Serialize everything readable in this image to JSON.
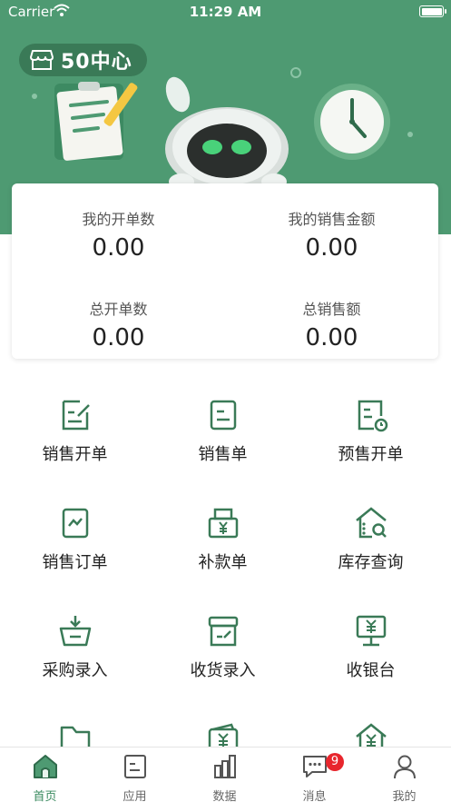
{
  "status_bar": {
    "carrier": "Carrier",
    "time": "11:29 AM"
  },
  "header": {
    "store_name": "50中心"
  },
  "stats": [
    {
      "label": "我的开单数",
      "value": "0.00"
    },
    {
      "label": "我的销售金额",
      "value": "0.00"
    },
    {
      "label": "总开单数",
      "value": "0.00"
    },
    {
      "label": "总销售额",
      "value": "0.00"
    }
  ],
  "features": [
    {
      "label": "销售开单",
      "icon": "edit-document-icon"
    },
    {
      "label": "销售单",
      "icon": "document-icon"
    },
    {
      "label": "预售开单",
      "icon": "document-clock-icon"
    },
    {
      "label": "销售订单",
      "icon": "chart-document-icon"
    },
    {
      "label": "补款单",
      "icon": "yuan-printer-icon"
    },
    {
      "label": "库存查询",
      "icon": "warehouse-search-icon"
    },
    {
      "label": "采购录入",
      "icon": "basket-download-icon"
    },
    {
      "label": "收货录入",
      "icon": "box-edit-icon"
    },
    {
      "label": "收银台",
      "icon": "cashier-monitor-icon"
    },
    {
      "label": "",
      "icon": "folder-icon"
    },
    {
      "label": "",
      "icon": "yuan-wallet-icon"
    },
    {
      "label": "",
      "icon": "yuan-house-icon"
    }
  ],
  "tabbar": {
    "items": [
      {
        "label": "首页",
        "icon": "home-icon",
        "active": true
      },
      {
        "label": "应用",
        "icon": "apps-icon",
        "active": false
      },
      {
        "label": "数据",
        "icon": "bar-chart-icon",
        "active": false
      },
      {
        "label": "消息",
        "icon": "message-icon",
        "active": false,
        "badge": "9"
      },
      {
        "label": "我的",
        "icon": "profile-icon",
        "active": false
      }
    ]
  },
  "colors": {
    "brand_green": "#4e9a72",
    "icon_green": "#3a7a57",
    "badge_red": "#e8262d"
  }
}
